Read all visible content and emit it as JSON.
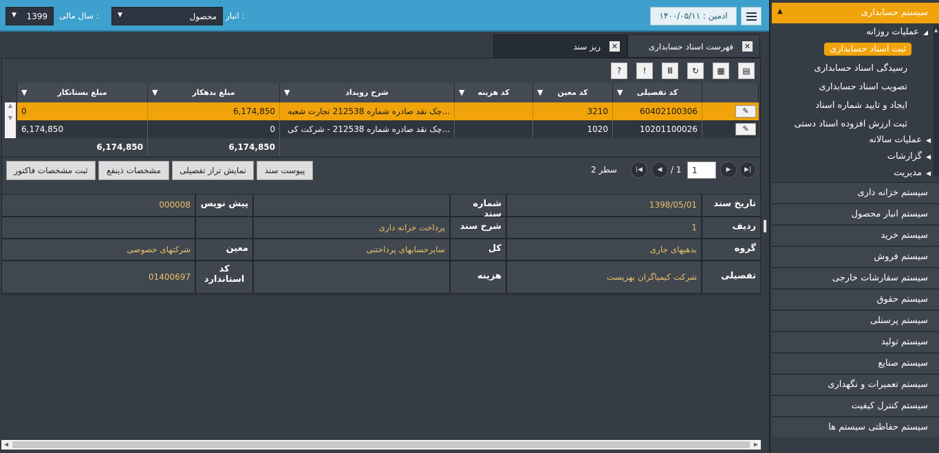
{
  "header": {
    "fiscal_year_label": "سال مالی :",
    "fiscal_year_value": "1399",
    "warehouse_label": "انبار :",
    "warehouse_value": "محصول",
    "user_info": "ادمین : ۱۴۰۰/۰۵/۱۱"
  },
  "tabs": [
    {
      "label": "فهرست اسناد حسابداری"
    },
    {
      "label": "ریز سند"
    }
  ],
  "grid": {
    "columns": [
      "کد تفصیلی",
      "کد معین",
      "کد هزینه",
      "شرح رویداد",
      "مبلغ بدهکار",
      "مبلغ بستانکار"
    ],
    "rows": [
      {
        "tafsili": "60402100306",
        "moein": "3210",
        "hazine": "",
        "sharh": "چک نقد صادره شماره 212538 تجارت شعبه...",
        "bedehkar": "6,174,850",
        "bestankar": "0"
      },
      {
        "tafsili": "10201100026",
        "moein": "1020",
        "hazine": "",
        "sharh": "چک نقد صادره شماره 212538 - شرکت کی...",
        "bedehkar": "0",
        "bestankar": "6,174,850"
      }
    ],
    "totals": {
      "bedehkar": "6,174,850",
      "bestankar": "6,174,850"
    }
  },
  "pager": {
    "page_value": "1",
    "of_text": "/ 1",
    "rows_count": "2 سطر"
  },
  "actions": {
    "attach": "پیوست سند",
    "detail_balance": "نمایش تراز تفصیلی",
    "beneficiary": "مشخصات ذینفع",
    "invoice": "ثبت مشخصات فاکتور"
  },
  "details": {
    "doc_date_label": "تاریخ سند",
    "doc_date_value": "1398/05/01",
    "doc_number_label": "شماره سند",
    "doc_number_value": "",
    "draft_label": "پیش نویس",
    "draft_value": "000008",
    "row_label": "ردیف",
    "row_value": "1",
    "doc_desc_label": "شرح سند",
    "doc_desc_value": "پرداخت خزانه داری",
    "group_label": "گروه",
    "group_value": "بدهیهای جاری",
    "kol_label": "کل",
    "kol_value": "سایرحسابهای پرداختنی",
    "moein_label": "معین",
    "moein_value": "شرکتهای خصوصی",
    "tafsili_label": "تفصیلی",
    "tafsili_value": "شرکت کیمیاگران بهزیست",
    "cost_label": "هزینه",
    "cost_value": "",
    "std_code_label": "کد استاندارد",
    "std_code_value": "01400697"
  },
  "sidebar": {
    "title": "سیستم حسابداری",
    "daily_ops": "عملیات روزانه",
    "daily_items": [
      "ثبت اسناد حسابداری",
      "رسیدگی اسناد حسابداری",
      "تصویب اسناد حسابداری",
      "ایجاد و تایید شماره اسناد",
      "ثبت ارزش افزوده اسناد دستی"
    ],
    "annual_ops": "عملیات سالانه",
    "reports": "گزارشات",
    "management": "مدیریت",
    "systems": [
      "سیستم خزانه داری",
      "سیستم انبار محصول",
      "سیستم خرید",
      "سیستم فروش",
      "سیستم سفارشات خارجی",
      "سیستم حقوق",
      "سیستم پرسنلی",
      "سیستم تولید",
      "سیستم صنایع",
      "سیستم تعمیرات و نگهداری",
      "سیستم کنترل کیفیت",
      "سیستم حفاظتی سیستم ها"
    ]
  }
}
